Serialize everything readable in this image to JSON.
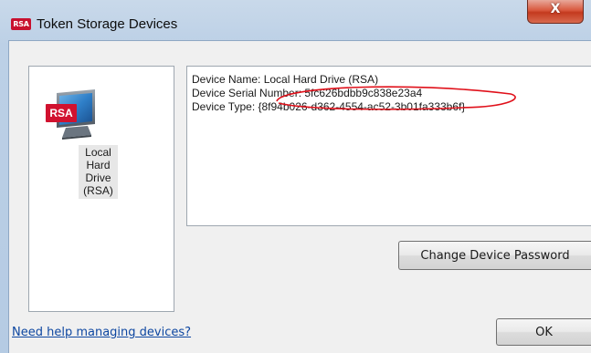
{
  "window": {
    "title": "Token Storage Devices",
    "icon_text": "RSA",
    "close_label": "X"
  },
  "device_list": {
    "items": [
      {
        "badge": "RSA",
        "label_lines": [
          "Local",
          "Hard",
          "Drive",
          "(RSA)"
        ]
      }
    ]
  },
  "details": {
    "device_name": "Device Name: Local Hard Drive (RSA)",
    "device_serial": "Device Serial Number: 5fc626bdbb9c838e23a4",
    "device_type": "Device Type: {8f94b026-d362-4554-ac52-3b01fa333b6f}"
  },
  "buttons": {
    "change_password": "Change Device Password",
    "ok": "OK"
  },
  "help": {
    "link_text": "Need help managing devices?"
  },
  "colors": {
    "title_bar": "#bcd0e6",
    "close_button": "#d9583e",
    "rsa_red": "#d1122f",
    "link_blue": "#0e47a1",
    "annotation_red": "#e0101a"
  }
}
